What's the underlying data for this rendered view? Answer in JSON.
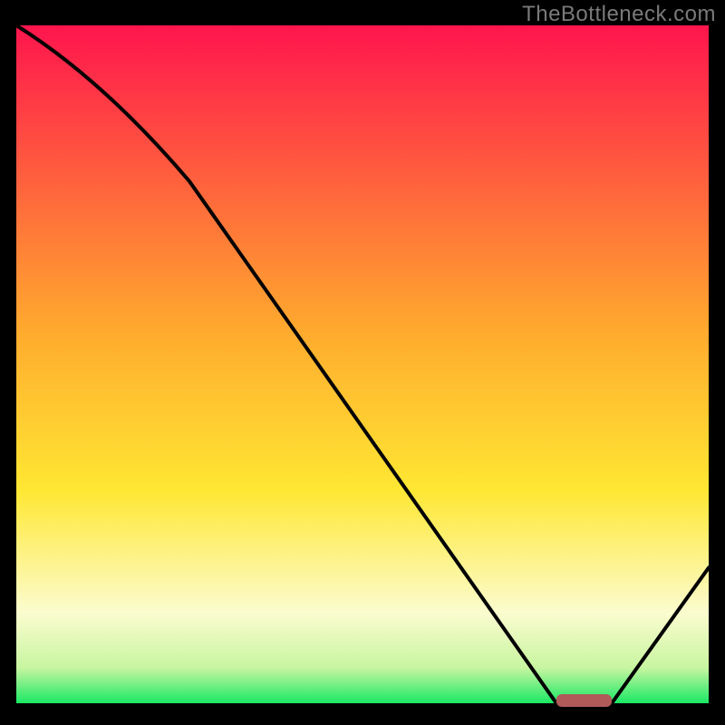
{
  "watermark": "TheBottleneck.com",
  "colors": {
    "frame_bg": "#000000",
    "curve": "#000000",
    "marker": "#b05a5a",
    "grad_top": "#ff154d",
    "grad_mid1": "#ff8b2a",
    "grad_mid2": "#ffe733",
    "grad_pale": "#fbfccf",
    "grad_green": "#00e65c"
  },
  "chart_data": {
    "type": "line",
    "title": "",
    "xlabel": "",
    "ylabel": "",
    "xlim": [
      0,
      100
    ],
    "ylim": [
      0,
      100
    ],
    "x": [
      0,
      25,
      78,
      86,
      100
    ],
    "values": [
      100,
      77,
      0,
      0,
      20
    ],
    "optimal_range_x": [
      78,
      86
    ],
    "gradient_stops": [
      {
        "pct": 0,
        "color": "#ff154d"
      },
      {
        "pct": 45,
        "color": "#ffab2e"
      },
      {
        "pct": 68,
        "color": "#ffe733"
      },
      {
        "pct": 86,
        "color": "#fbfccf"
      },
      {
        "pct": 94,
        "color": "#c8f5a0"
      },
      {
        "pct": 100,
        "color": "#00e65c"
      }
    ]
  }
}
